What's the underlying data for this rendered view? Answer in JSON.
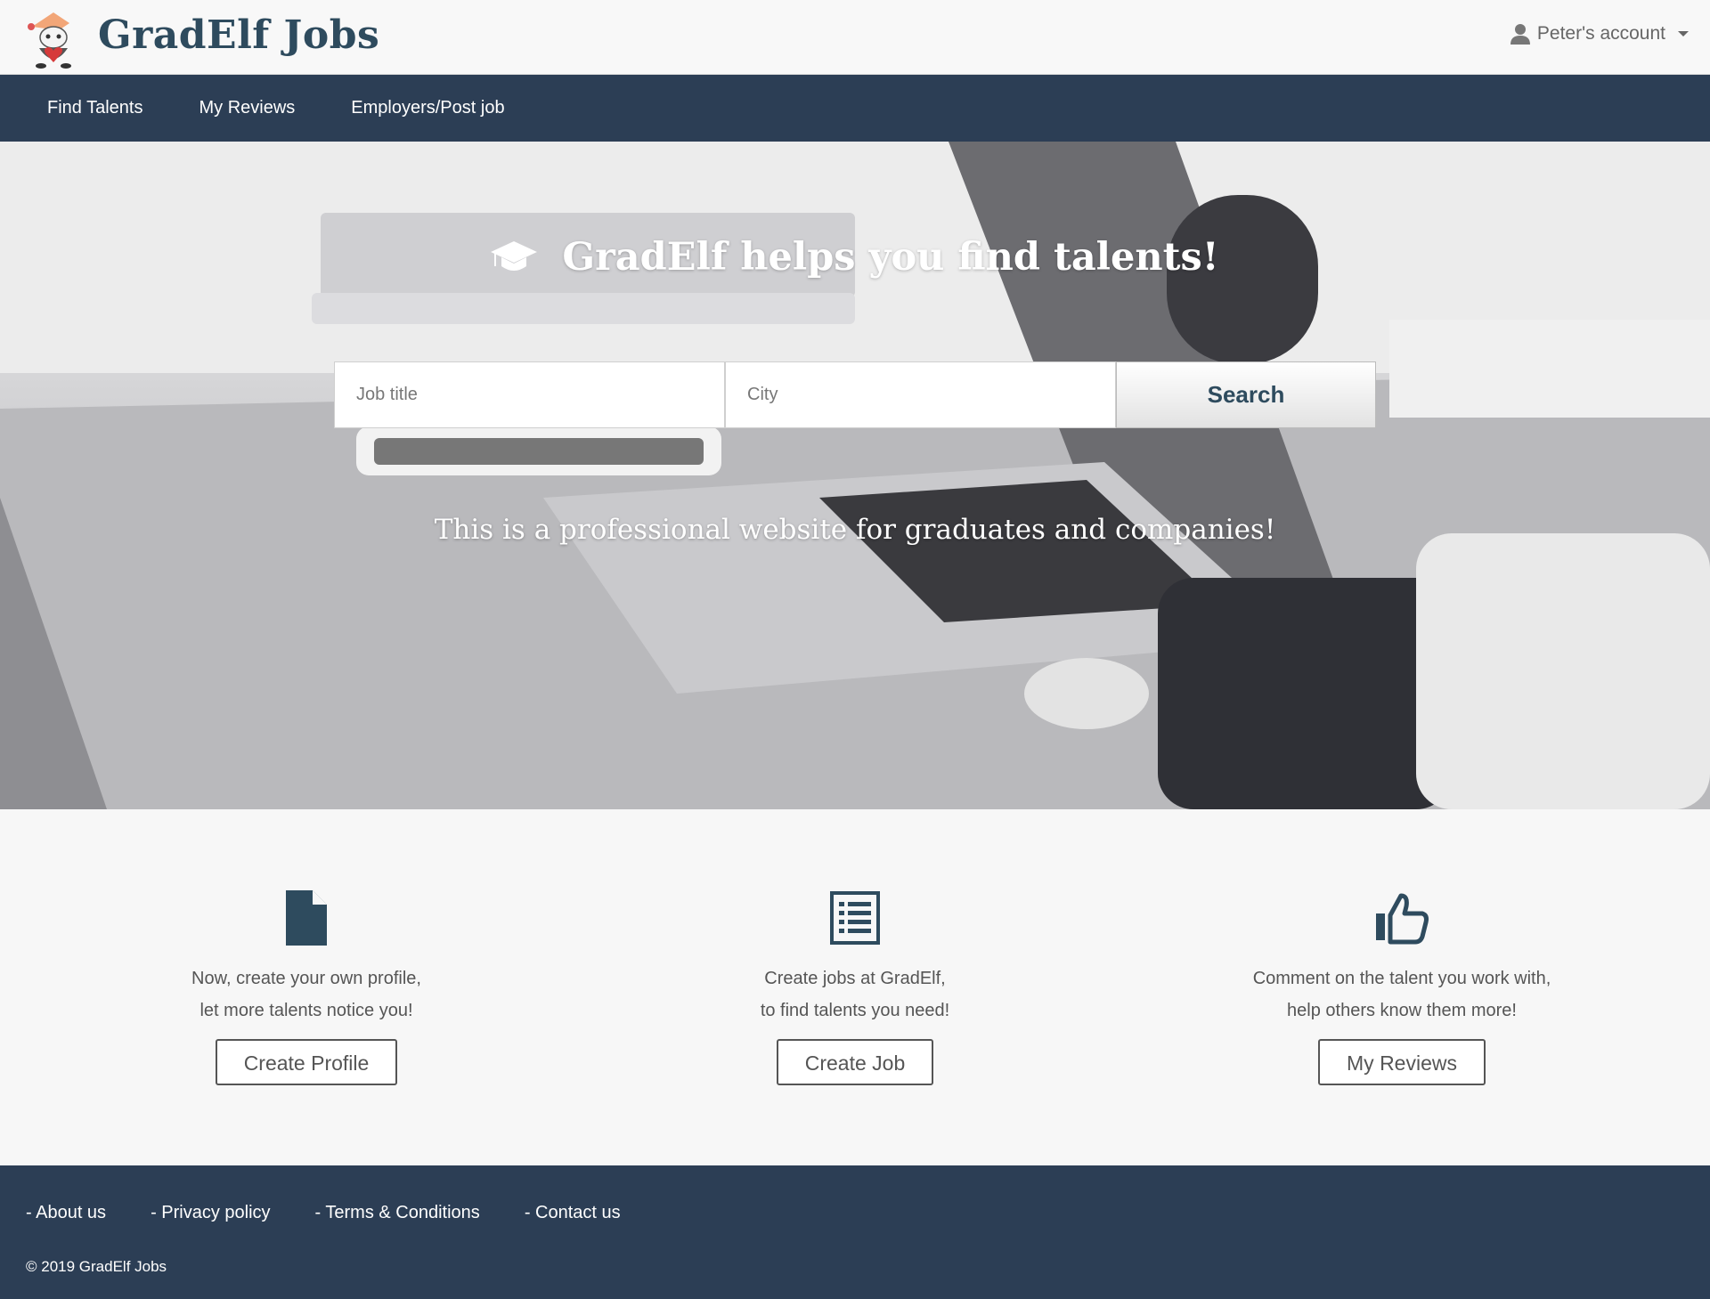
{
  "header": {
    "brand": "GradElf Jobs",
    "account_label": "Peter's account"
  },
  "nav": {
    "items": [
      "Find Talents",
      "My Reviews",
      "Employers/Post job"
    ]
  },
  "hero": {
    "title": "GradElf helps you find talents!",
    "subtitle": "This is a professional website for graduates and companies!",
    "search": {
      "job_placeholder": "Job title",
      "job_value": "",
      "city_placeholder": "City",
      "city_value": "",
      "button_label": "Search"
    }
  },
  "features": [
    {
      "icon": "file-icon",
      "line1": "Now, create your own profile,",
      "line2": "let more talents notice you!",
      "button": "Create Profile"
    },
    {
      "icon": "list-icon",
      "line1": "Create jobs at GradElf,",
      "line2": "to find talents you need!",
      "button": "Create Job"
    },
    {
      "icon": "thumbs-up-icon",
      "line1": "Comment on the talent you work with,",
      "line2": "help others know them more!",
      "button": "My Reviews"
    }
  ],
  "footer": {
    "links": [
      "- About us",
      "- Privacy policy",
      "- Terms & Conditions",
      "- Contact us"
    ],
    "copyright": "© 2019 GradElf Jobs"
  },
  "colors": {
    "brand": "#2e4b5e",
    "navbar": "#2c3e55",
    "footer": "#2c3e55"
  }
}
